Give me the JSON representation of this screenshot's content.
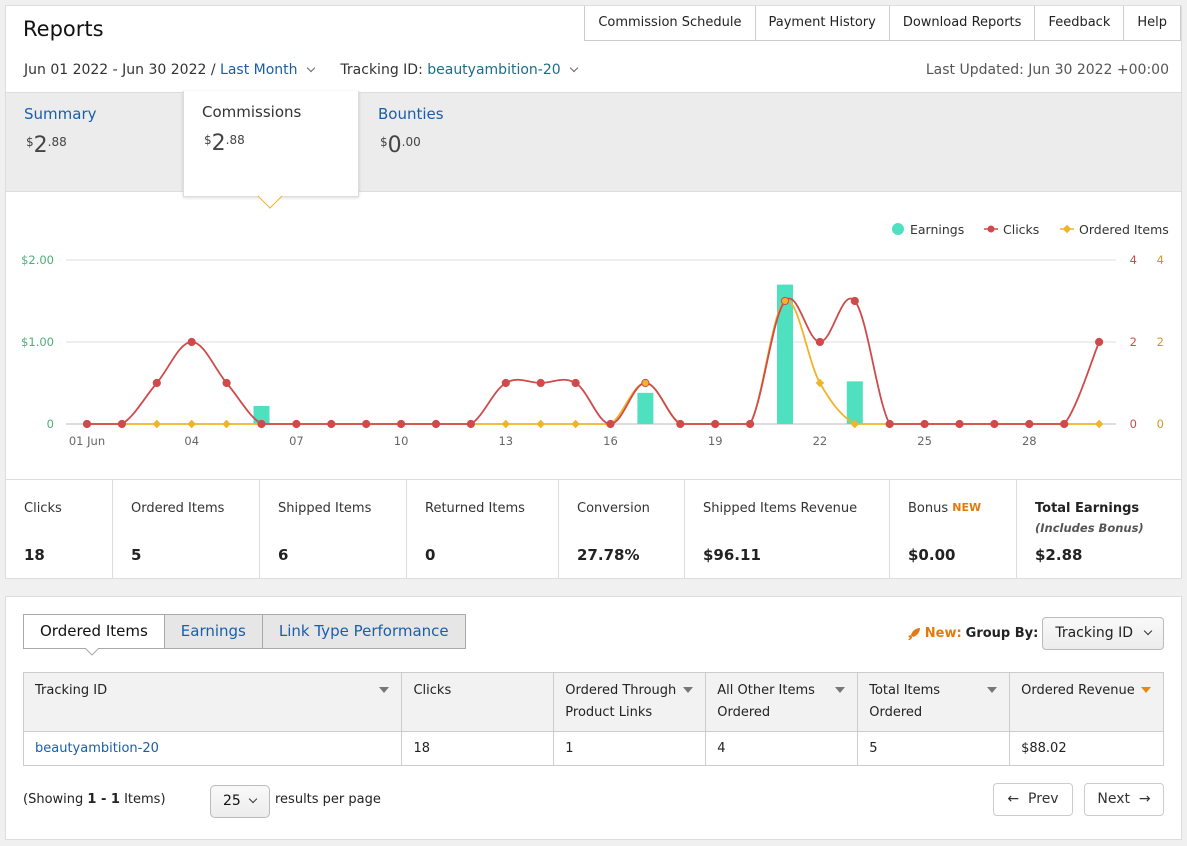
{
  "header": {
    "title": "Reports",
    "nav": [
      "Commission Schedule",
      "Payment History",
      "Download Reports",
      "Feedback",
      "Help"
    ],
    "date_range": "Jun 01 2022 - Jun 30 2022 /",
    "date_preset": "Last Month",
    "tracking_label": "Tracking ID:",
    "tracking_value": "beautyambition-20",
    "last_updated": "Last Updated: Jun 30 2022 +00:00"
  },
  "summary_tabs": [
    {
      "label": "Summary",
      "currency": "$",
      "int": "2",
      "dec": ".88"
    },
    {
      "label": "Commissions",
      "currency": "$",
      "int": "2",
      "dec": ".88"
    },
    {
      "label": "Bounties",
      "currency": "$",
      "int": "0",
      "dec": ".00"
    }
  ],
  "chart_data": {
    "type": "line",
    "legend": [
      "Earnings",
      "Clicks",
      "Ordered Items"
    ],
    "legend_position": "top-right",
    "colors": {
      "earnings": "#4fe0c0",
      "clicks": "#cf4b4b",
      "ordered": "#f0b429"
    },
    "x_tick_labels": [
      "01 Jun",
      "04",
      "07",
      "10",
      "13",
      "16",
      "19",
      "22",
      "25",
      "28"
    ],
    "x_tick_days": [
      1,
      4,
      7,
      10,
      13,
      16,
      19,
      22,
      25,
      28
    ],
    "days": [
      1,
      2,
      3,
      4,
      5,
      6,
      7,
      8,
      9,
      10,
      11,
      12,
      13,
      14,
      15,
      16,
      17,
      18,
      19,
      20,
      21,
      22,
      23,
      24,
      25,
      26,
      27,
      28,
      29,
      30
    ],
    "left_axis": {
      "ticks": [
        "$2.00",
        "$1.00",
        "0"
      ],
      "values": [
        2,
        1,
        0
      ],
      "ylim": [
        0,
        2
      ]
    },
    "right_axis_clicks": {
      "ticks": [
        "4",
        "2",
        "0"
      ],
      "values": [
        4,
        2,
        0
      ],
      "ylim": [
        0,
        4
      ]
    },
    "right_axis_ordered": {
      "ticks": [
        "4",
        "2",
        "0"
      ],
      "values": [
        4,
        2,
        0
      ],
      "ylim": [
        0,
        4
      ]
    },
    "series": [
      {
        "name": "Earnings",
        "kind": "bar",
        "values": [
          0,
          0,
          0,
          0,
          0,
          0.22,
          0,
          0,
          0,
          0,
          0,
          0,
          0,
          0,
          0,
          0,
          0.38,
          0,
          0,
          0,
          1.7,
          0,
          0.52,
          0,
          0,
          0,
          0,
          0,
          0,
          0
        ]
      },
      {
        "name": "Clicks",
        "kind": "line",
        "values": [
          0,
          0,
          1,
          2,
          1,
          0,
          0,
          0,
          0,
          0,
          0,
          0,
          1,
          1,
          1,
          0,
          1,
          0,
          0,
          0,
          3,
          2,
          3,
          0,
          0,
          0,
          0,
          0,
          0,
          2
        ]
      },
      {
        "name": "Ordered Items",
        "kind": "line",
        "values": [
          0,
          0,
          0,
          0,
          0,
          0,
          0,
          0,
          0,
          0,
          0,
          0,
          0,
          0,
          0,
          0,
          1,
          0,
          0,
          0,
          3,
          1,
          0,
          0,
          0,
          0,
          0,
          0,
          0,
          0
        ]
      }
    ]
  },
  "metrics": [
    {
      "label": "Clicks",
      "value": "18"
    },
    {
      "label": "Ordered Items",
      "value": "5"
    },
    {
      "label": "Shipped Items",
      "value": "6"
    },
    {
      "label": "Returned Items",
      "value": "0"
    },
    {
      "label": "Conversion",
      "value": "27.78%"
    },
    {
      "label": "Shipped Items Revenue",
      "value": "$96.11"
    },
    {
      "label": "Bonus",
      "badge": "NEW",
      "value": "$0.00"
    },
    {
      "label": "Total Earnings",
      "sub": "(Includes Bonus)",
      "value": "$2.88"
    }
  ],
  "bottom": {
    "tabs": [
      "Ordered Items",
      "Earnings",
      "Link Type Performance"
    ],
    "new_label": "New:",
    "group_by_label": "Group By:",
    "group_by_value": "Tracking ID",
    "table": {
      "headers": [
        "Tracking ID",
        "Clicks",
        "Ordered Through Product Links",
        "All Other Items Ordered",
        "Total Items Ordered",
        "Ordered Revenue"
      ],
      "rows": [
        [
          "beautyambition-20",
          "18",
          "1",
          "4",
          "5",
          "$88.02"
        ]
      ]
    },
    "showing_prefix": "(Showing",
    "showing_range": "1 - 1",
    "showing_suffix": "Items)",
    "per_page_value": "25",
    "per_page_label": "results per page",
    "prev_label": "Prev",
    "next_label": "Next",
    "prev_arrow": "←",
    "next_arrow": "→"
  }
}
